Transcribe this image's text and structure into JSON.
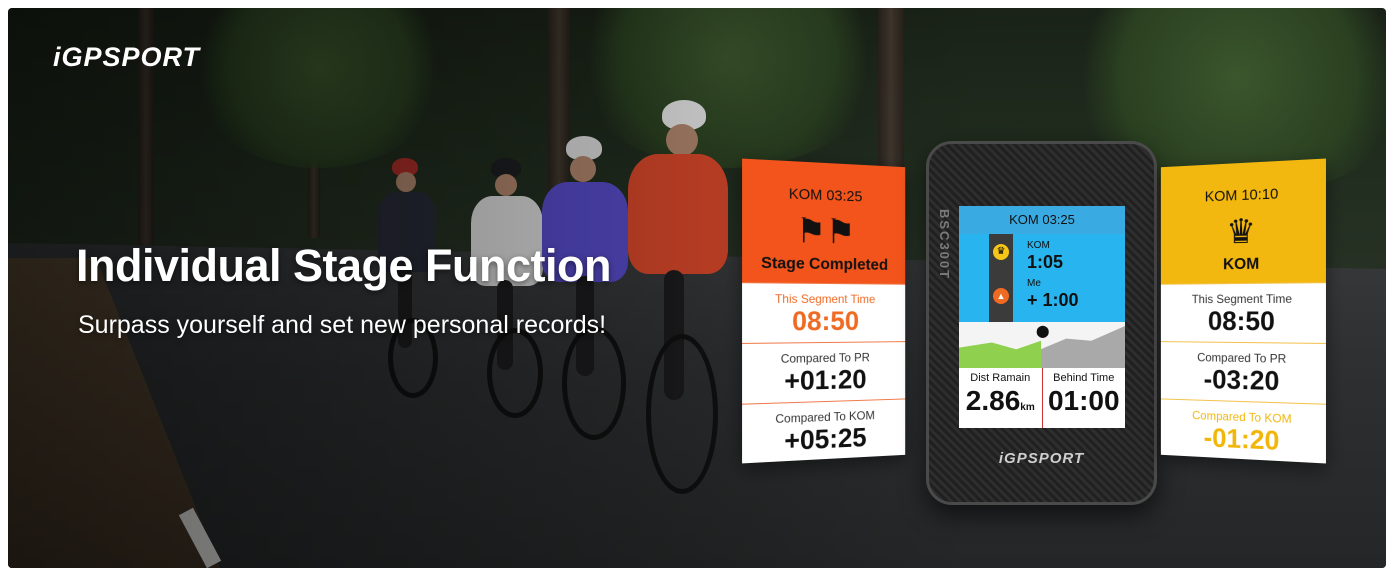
{
  "brand": {
    "logo": "iGPSPORT"
  },
  "hero": {
    "title": "Individual Stage Function",
    "subtitle": "Surpass yourself and set new personal records!"
  },
  "card_left": {
    "header": "KOM 03:25",
    "icon": "checkered-flags-icon",
    "status": "Stage Completed",
    "rows": [
      {
        "label": "This Segment Time",
        "value": "08:50"
      },
      {
        "label": "Compared To PR",
        "value": "+01:20"
      },
      {
        "label": "Compared To KOM",
        "value": "+05:25"
      }
    ]
  },
  "device": {
    "side_brand": "BSC300T",
    "header": "KOM 03:25",
    "kom_label": "KOM",
    "kom_value": "1:05",
    "me_label": "Me",
    "me_value": "+ 1:00",
    "dist_label": "Dist Ramain",
    "dist_value": "2.86",
    "dist_unit": "km",
    "behind_label": "Behind Time",
    "behind_value": "01:00",
    "bottom_brand": "iGPSPORT"
  },
  "card_right": {
    "header": "KOM 10:10",
    "icon": "crown-icon",
    "status": "KOM",
    "rows": [
      {
        "label": "This Segment Time",
        "value": "08:50"
      },
      {
        "label": "Compared To PR",
        "value": "-03:20"
      },
      {
        "label": "Compared To KOM",
        "value": "-01:20"
      }
    ]
  },
  "colors": {
    "orange_accent": "#f2541c",
    "yellow_accent": "#f3b80f",
    "screen_blue": "#27b4ef"
  }
}
